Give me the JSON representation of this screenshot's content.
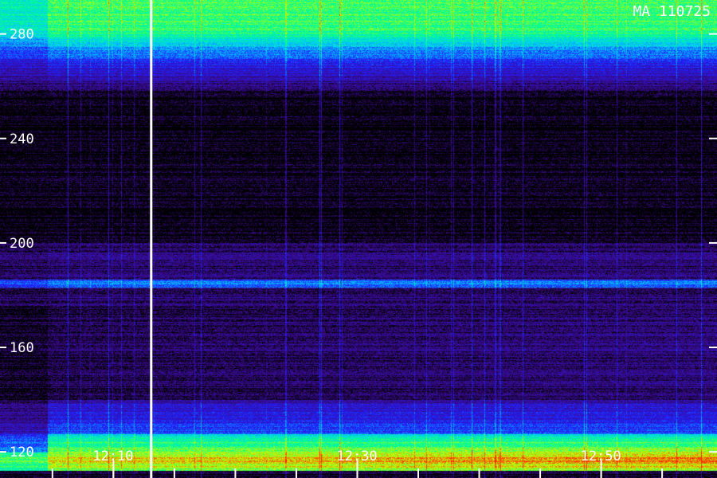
{
  "chart_data": {
    "type": "heatmap",
    "title": "",
    "stamp": "MA 110725",
    "xlabel": "",
    "ylabel": "",
    "x_tick_labels": [
      "12:10",
      "12:30",
      "12:50"
    ],
    "x_label_values": [
      10,
      30,
      50
    ],
    "x_range_minutes": [
      0.7,
      59.5
    ],
    "x_minor_tick_values": [
      5,
      10,
      15,
      20,
      25,
      30,
      35,
      40,
      45,
      50,
      55
    ],
    "y_tick_labels": [
      "280",
      "240",
      "200",
      "160",
      "120"
    ],
    "y_tick_values": [
      280,
      240,
      200,
      160,
      120
    ],
    "y_range": [
      110,
      293
    ],
    "marker_line_minutes": 13.1,
    "colormap": [
      "#000000",
      "#3a0a8a",
      "#2020ff",
      "#00c8ff",
      "#00ff90",
      "#c8ff00",
      "#ff2000"
    ],
    "bands": [
      {
        "y_low": 274,
        "y_high": 293,
        "level": "high"
      },
      {
        "y_low": 183,
        "y_high": 186,
        "level": "medium"
      },
      {
        "y_low": 113,
        "y_high": 127,
        "level": "very high"
      }
    ],
    "grid": false,
    "legend": "none"
  }
}
